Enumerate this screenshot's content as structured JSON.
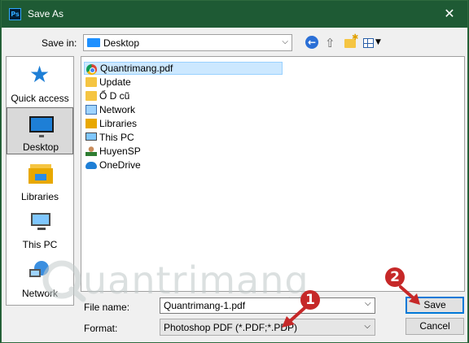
{
  "window": {
    "title": "Save As",
    "app_icon_text": "Ps",
    "close_glyph": "✕"
  },
  "toolbar": {
    "save_in_label": "Save in:",
    "save_in_value": "Desktop",
    "back_icon": "back-arrow-icon",
    "up_icon": "up-folder-icon",
    "new_folder_icon": "new-folder-icon",
    "view_icon": "view-menu-icon"
  },
  "places": [
    {
      "label": "Quick access",
      "icon": "star-icon"
    },
    {
      "label": "Desktop",
      "icon": "desktop-icon",
      "selected": true
    },
    {
      "label": "Libraries",
      "icon": "libraries-icon"
    },
    {
      "label": "This PC",
      "icon": "computer-icon"
    },
    {
      "label": "Network",
      "icon": "network-icon"
    }
  ],
  "files": [
    {
      "name": "Quantrimang.pdf",
      "icon": "chrome-pdf-icon",
      "selected": true
    },
    {
      "name": "Update",
      "icon": "folder-icon"
    },
    {
      "name": "Ổ D cũ",
      "icon": "folder-icon"
    },
    {
      "name": "Network",
      "icon": "network-icon"
    },
    {
      "name": "Libraries",
      "icon": "libraries-icon"
    },
    {
      "name": "This PC",
      "icon": "computer-icon"
    },
    {
      "name": "HuyenSP",
      "icon": "user-icon"
    },
    {
      "name": "OneDrive",
      "icon": "onedrive-icon"
    }
  ],
  "form": {
    "file_name_label": "File name:",
    "file_name_value": "Quantrimang-1.pdf",
    "format_label": "Format:",
    "format_value": "Photoshop PDF (*.PDF;*.PDP)"
  },
  "buttons": {
    "save": "Save",
    "cancel": "Cancel"
  },
  "annotations": {
    "badge_1": "1",
    "badge_2": "2",
    "color": "#c62828"
  },
  "watermark": "uantrimang"
}
